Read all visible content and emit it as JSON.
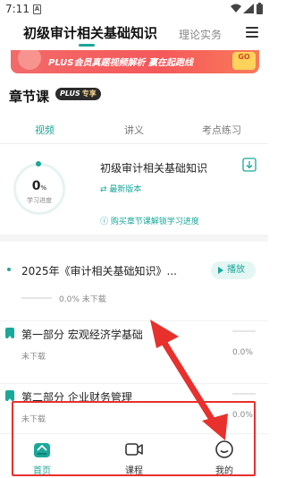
{
  "status_bar": {
    "time": "7:11",
    "sim_label": "A"
  },
  "top_nav": {
    "active_tab": "初级审计相关基础知识",
    "other_tab": "理论实务"
  },
  "banner": {
    "text": "PLUS会员真题视频解析 赢在起跑线",
    "badge": "GO"
  },
  "section": {
    "title": "章节课",
    "badge_plus": "PLUS",
    "badge_sub": "专享"
  },
  "sub_tabs": [
    "视频",
    "讲义",
    "考点练习"
  ],
  "course_card": {
    "progress_value": "0",
    "progress_unit": "%",
    "progress_label": "学习进度",
    "name": "初级审计相关基础知识",
    "version": "最新版本",
    "unlock_text": "购买章节课解锁学习进度"
  },
  "lesson_2025": {
    "title": "2025年《审计相关基础知识》...",
    "play_label": "播放",
    "progress": "0.0%",
    "status": "未下载"
  },
  "parts": [
    {
      "title": "第一部分 宏观经济学基础",
      "status": "未下载",
      "progress": "0.0%"
    },
    {
      "title": "第二部分 企业财务管理",
      "status": "未下载",
      "progress": "0.0%"
    }
  ],
  "tab_bar": {
    "home": "首页",
    "courses": "课程",
    "mine": "我的"
  },
  "colors": {
    "accent": "#1aa89a",
    "highlight": "#e8302d"
  },
  "icons": [
    "sim-icon",
    "wifi-icon",
    "signal-icon",
    "battery-icon",
    "menu-icon",
    "download-icon",
    "refresh-icon",
    "info-icon",
    "play-icon",
    "bookmark-icon",
    "home-icon",
    "video-icon",
    "smile-icon"
  ]
}
